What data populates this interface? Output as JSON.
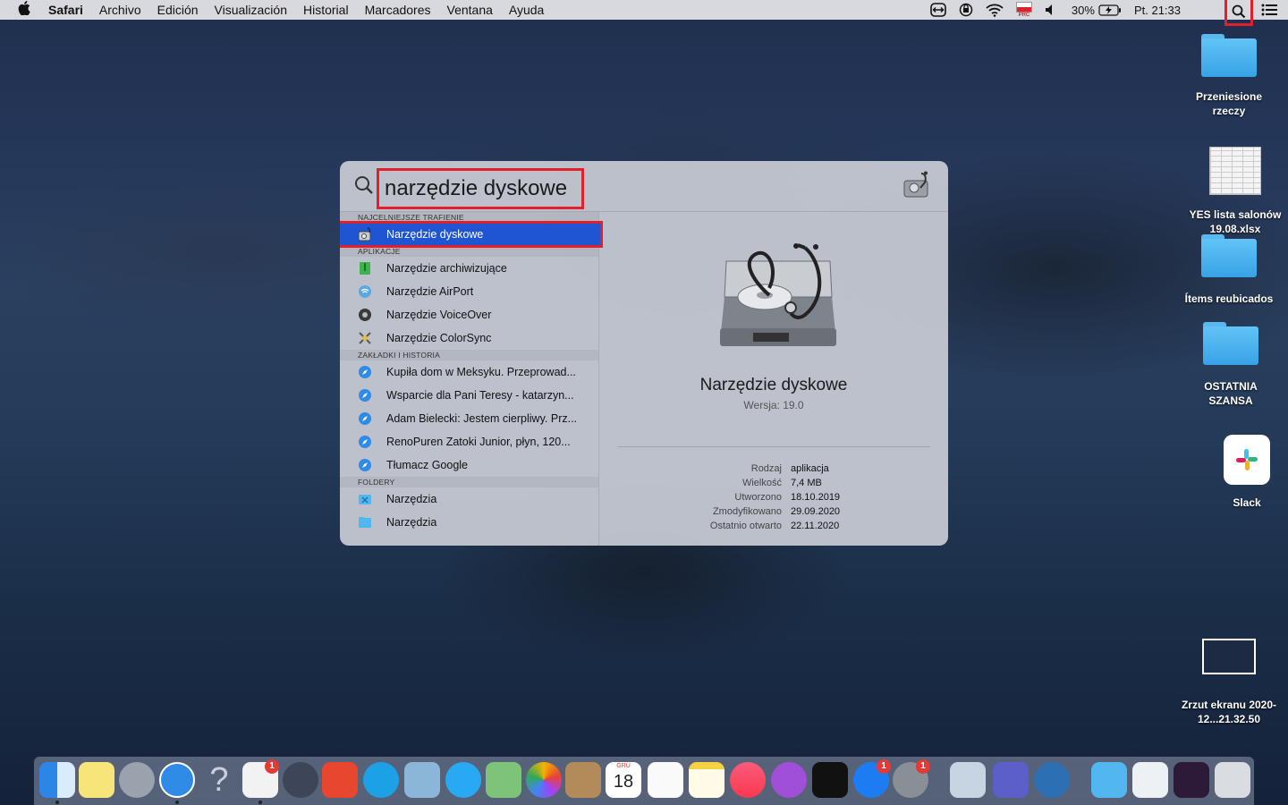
{
  "menubar": {
    "app_name": "Safari",
    "menus": [
      "Archivo",
      "Edición",
      "Visualización",
      "Historial",
      "Marcadores",
      "Ventana",
      "Ayuda"
    ],
    "battery": "30%",
    "clock": "Pt. 21:33",
    "flag_label": "PRC"
  },
  "spotlight": {
    "query": "narzędzie dyskowe",
    "sections": {
      "top_hit": "NAJCELNIEJSZE TRAFIENIE",
      "apps": "APLIKACJE",
      "bookmarks": "ZAKŁADKI I HISTORIA",
      "folders": "FOLDERY"
    },
    "top_hit": "Narzędzie dyskowe",
    "apps": [
      "Narzędzie archiwizujące",
      "Narzędzie AirPort",
      "Narzędzie VoiceOver",
      "Narzędzie ColorSync"
    ],
    "bookmarks": [
      "Kupiła dom w Meksyku. Przeprowad...",
      "Wsparcie dla Pani Teresy - katarzyn...",
      "Adam Bielecki: Jestem cierpliwy. Prz...",
      "RenoPuren Zatoki Junior, płyn, 120...",
      "Tłumacz Google"
    ],
    "folders": [
      "Narzędzia",
      "Narzędzia"
    ],
    "preview": {
      "name": "Narzędzie dyskowe",
      "version": "Wersja: 19.0",
      "meta": [
        {
          "k": "Rodzaj",
          "v": "aplikacja"
        },
        {
          "k": "Wielkość",
          "v": "7,4 MB"
        },
        {
          "k": "Utworzono",
          "v": "18.10.2019"
        },
        {
          "k": "Zmodyfikowano",
          "v": "29.09.2020"
        },
        {
          "k": "Ostatnio otwarto",
          "v": "22.11.2020"
        }
      ]
    }
  },
  "desktop": {
    "icons": [
      {
        "label": "Przeniesione rzeczy"
      },
      {
        "label": "YES lista salonów 19.08.xlsx"
      },
      {
        "label": "Ítems reubicados"
      },
      {
        "label": "OSTATNIA SZANSA"
      },
      {
        "label": "Slack"
      },
      {
        "label": "Zrzut ekranu 2020-12...21.32.50"
      }
    ]
  },
  "dock": {
    "calendar_month": "GRU",
    "calendar_day": "18",
    "badges": [
      "1",
      "1",
      "1"
    ],
    "apps": [
      "finder-icon",
      "stickies-icon",
      "launchpad-icon",
      "safari-icon",
      "help-icon",
      "textedit-icon",
      "keychain-icon",
      "anydesk-icon",
      "skype-icon",
      "preview-icon",
      "messages-icon",
      "maps-icon",
      "photos-icon",
      "contacts-icon",
      "calendar-icon",
      "reminders-icon",
      "notes-icon",
      "music-icon",
      "podcasts-icon",
      "appletv-icon",
      "appstore-icon",
      "systemprefs-icon",
      "imagecapture-icon",
      "teams-icon",
      "quicktime-icon",
      "folder-icon",
      "document-icon",
      "screenshot-icon",
      "trash-icon"
    ]
  }
}
